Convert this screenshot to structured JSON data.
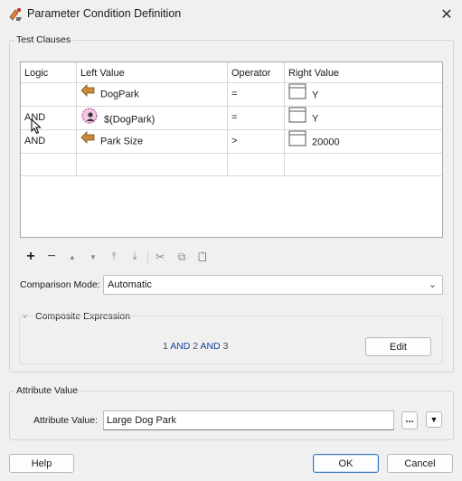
{
  "window": {
    "title": "Parameter Condition Definition",
    "close_glyph": "✕"
  },
  "test_clauses": {
    "label": "Test Clauses",
    "columns": [
      "Logic",
      "Left Value",
      "Operator",
      "Right Value"
    ],
    "rows": [
      {
        "logic": "",
        "left_icon": "attribute-arrow-icon",
        "left": "DogPark",
        "operator": "=",
        "right_icon": "value-box-icon",
        "right": "Y"
      },
      {
        "logic": "AND",
        "left_icon": "user-parameter-icon",
        "left": "$(DogPark)",
        "operator": "=",
        "right_icon": "value-box-icon",
        "right": "Y"
      },
      {
        "logic": "AND",
        "left_icon": "attribute-arrow-icon",
        "left": "Park Size",
        "operator": ">",
        "right_icon": "value-box-icon",
        "right": "20000"
      },
      {
        "logic": "",
        "left_icon": "",
        "left": "",
        "operator": "",
        "right_icon": "",
        "right": ""
      }
    ]
  },
  "toolbar": {
    "items": [
      {
        "name": "add-row-icon",
        "glyph": "+"
      },
      {
        "name": "remove-row-icon",
        "glyph": "−"
      },
      {
        "name": "move-up-icon",
        "glyph": "▲"
      },
      {
        "name": "move-down-icon",
        "glyph": "▼"
      },
      {
        "name": "move-top-icon",
        "glyph": "⤒"
      },
      {
        "name": "move-bottom-icon",
        "glyph": "⤓"
      },
      {
        "name": "cut-icon",
        "glyph": "✂"
      },
      {
        "name": "copy-icon",
        "glyph": "⧉"
      },
      {
        "name": "paste-icon",
        "glyph": "📋"
      }
    ]
  },
  "comparison_mode": {
    "label": "Comparison Mode:",
    "value": "Automatic",
    "chevron": "⌄"
  },
  "composite": {
    "toggle_glyph": "⌄",
    "label": "Composite Expression",
    "expression": {
      "n1": "1",
      "op1": "AND",
      "n2": "2",
      "op2": "AND",
      "n3": "3"
    },
    "edit_label": "Edit"
  },
  "attribute_value": {
    "group_label": "Attribute Value",
    "field_label": "Attribute Value:",
    "value": "Large Dog Park",
    "ellipsis_label": "...",
    "dropdown_glyph": "▼"
  },
  "footer": {
    "help_label": "Help",
    "ok_label": "OK",
    "cancel_label": "Cancel"
  },
  "colors": {
    "expression_number": "#444466",
    "expression_operator": "#1a3fa0",
    "attribute_icon": "#c98a3a",
    "parameter_icon": "#d07ab8"
  }
}
